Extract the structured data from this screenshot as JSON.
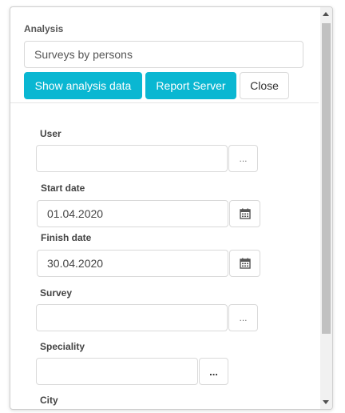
{
  "analysis": {
    "label": "Analysis",
    "value": "Surveys by persons"
  },
  "buttons": {
    "show_analysis": "Show analysis data",
    "report_server": "Report Server",
    "close": "Close"
  },
  "form": {
    "user": {
      "label": "User",
      "value": "",
      "picker": "..."
    },
    "start_date": {
      "label": "Start date",
      "value": "01.04.2020",
      "icon": "calendar-icon"
    },
    "finish_date": {
      "label": "Finish date",
      "value": "30.04.2020",
      "icon": "calendar-icon"
    },
    "survey": {
      "label": "Survey",
      "value": "",
      "picker": "..."
    },
    "speciality": {
      "label": "Speciality",
      "value": "",
      "picker": "..."
    },
    "city": {
      "label": "City"
    }
  },
  "colors": {
    "primary": "#0ab7d2",
    "border": "#d9d9d9"
  }
}
